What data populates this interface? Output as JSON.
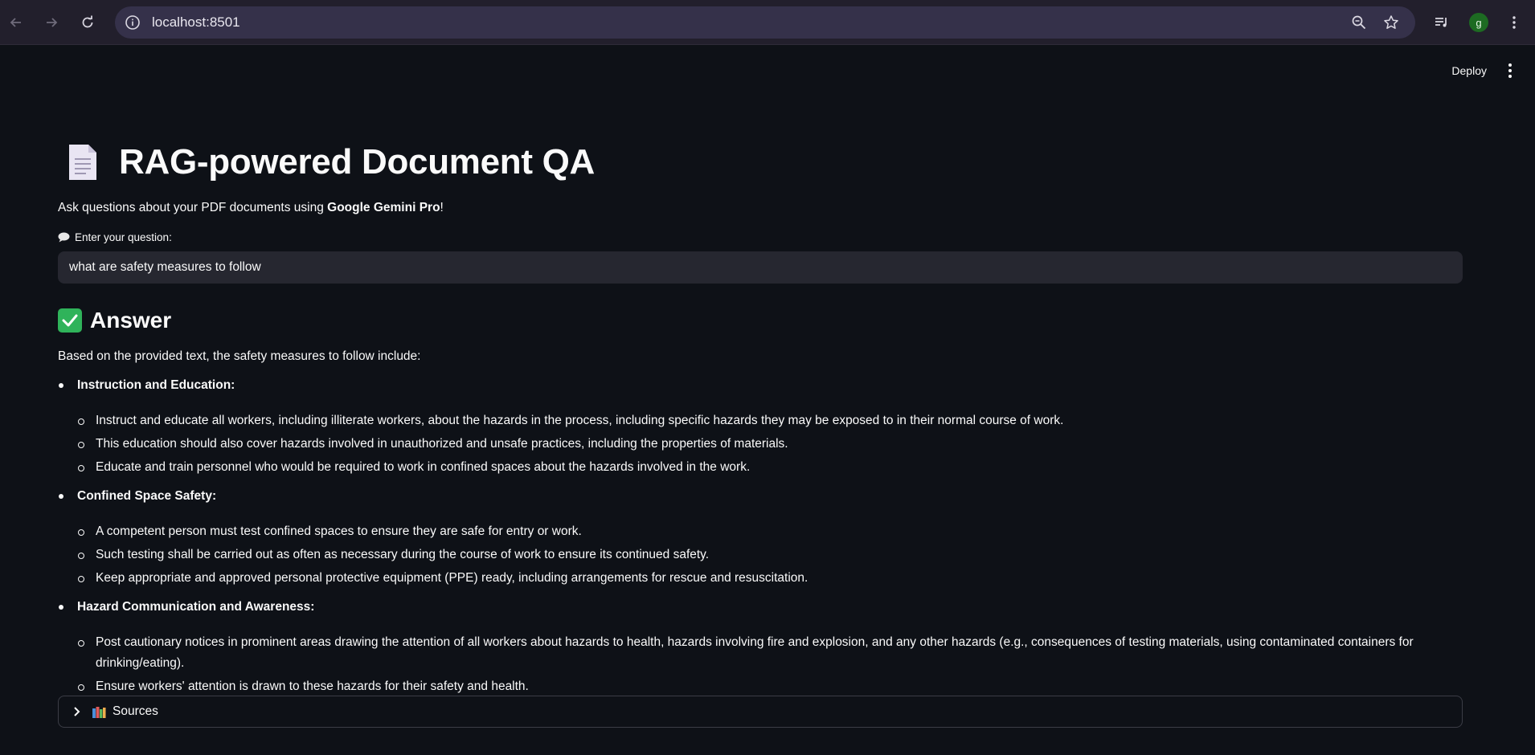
{
  "browser": {
    "url": "localhost:8501",
    "profile_initial": "g",
    "icons": {
      "back": "arrow-back-icon",
      "forward": "arrow-forward-icon",
      "reload": "reload-icon",
      "info": "site-info-icon",
      "zoom": "zoom-icon",
      "bookmark": "star-icon",
      "media": "media-queue-icon",
      "menu": "kebab-menu-icon"
    }
  },
  "app": {
    "deploy_label": "Deploy",
    "title": "RAG-powered Document QA",
    "title_icon": "document-icon",
    "subtitle_prefix": "Ask questions about your PDF documents using ",
    "subtitle_bold": "Google Gemini Pro",
    "subtitle_suffix": "!",
    "question_label": "Enter your question:",
    "question_value": "what are safety measures to follow",
    "answer_heading": "Answer",
    "answer_intro": "Based on the provided text, the safety measures to follow include:",
    "sections": [
      {
        "title": "Instruction and Education:",
        "items": [
          "Instruct and educate all workers, including illiterate workers, about the hazards in the process, including specific hazards they may be exposed to in their normal course of work.",
          "This education should also cover hazards involved in unauthorized and unsafe practices, including the properties of materials.",
          "Educate and train personnel who would be required to work in confined spaces about the hazards involved in the work."
        ]
      },
      {
        "title": "Confined Space Safety:",
        "items": [
          "A competent person must test confined spaces to ensure they are safe for entry or work.",
          "Such testing shall be carried out as often as necessary during the course of work to ensure its continued safety.",
          "Keep appropriate and approved personal protective equipment (PPE) ready, including arrangements for rescue and resuscitation."
        ]
      },
      {
        "title": "Hazard Communication and Awareness:",
        "items": [
          "Post cautionary notices in prominent areas drawing the attention of all workers about hazards to health, hazards involving fire and explosion, and any other hazards (e.g., consequences of testing materials, using contaminated containers for drinking/eating).",
          "Ensure workers' attention is drawn to these hazards for their safety and health."
        ]
      }
    ],
    "sources_label": "Sources"
  },
  "colors": {
    "background": "#0e1117",
    "chrome": "#221f2c",
    "omnibox": "#35314a",
    "input": "#262730",
    "success": "#2fb35a",
    "avatar": "#1d6b22"
  }
}
